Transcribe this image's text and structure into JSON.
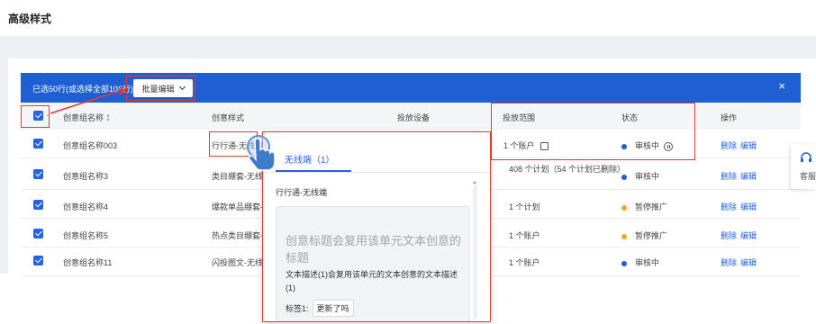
{
  "page": {
    "title": "高级样式"
  },
  "batch_bar": {
    "selection_text": "已选50行(或选择全部106行)",
    "batch_edit_label": "批量编辑",
    "close_glyph": "×"
  },
  "table": {
    "headers": {
      "name": "创意组名称",
      "style": "创意样式",
      "device": "投放设备",
      "scope": "投放范围",
      "status": "状态",
      "actions": "操作"
    },
    "rows": [
      {
        "name": "创意组名称003",
        "style": "行行通-无线端",
        "scope": "1 个账户",
        "status": "审核中",
        "status_color": "#1f5fd4",
        "del": "删除",
        "edit": "编辑"
      },
      {
        "name": "创意组名称3",
        "style": "类目绷套-无线",
        "scope": "408 个计划（54 个计划已删除）",
        "status": "审核中",
        "status_color": "#1f5fd4",
        "del": "删除",
        "edit": "编辑"
      },
      {
        "name": "创意组名称4",
        "style": "爆款单品绷套-",
        "scope": "1 个计划",
        "status": "暂停推广",
        "status_color": "#f5a623",
        "del": "删除",
        "edit": "编辑"
      },
      {
        "name": "创意组名称5",
        "style": "热点类目绷套-",
        "scope": "1 个账户",
        "status": "暂停推广",
        "status_color": "#f5a623",
        "del": "删除",
        "edit": "编辑"
      },
      {
        "name": "创意组名称11",
        "style": "闪投图文-无线端",
        "scope": "1 个账户",
        "status": "审核中",
        "status_color": "#1f5fd4",
        "del": "删除",
        "edit": "编辑"
      }
    ]
  },
  "popup": {
    "tab_label": "无线端（1）",
    "section_label": "行行通-无线端",
    "card_title": "创意标题会复用该单元文本创意的标题",
    "card_desc": "文本描述(1)会复用该单元的文本创意的文本描述(1)",
    "tag_label": "标签1:",
    "tag_value": "更新了吗"
  },
  "customer_service": {
    "label": "客服"
  },
  "colors": {
    "accent": "#1f5fd4",
    "highlight": "#e53935",
    "paused": "#f5a623"
  }
}
